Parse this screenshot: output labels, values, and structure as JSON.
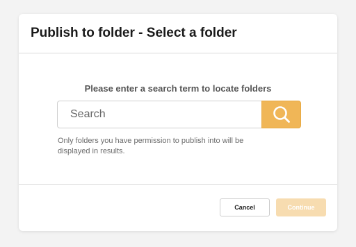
{
  "dialog": {
    "title": "Publish to folder - Select a folder"
  },
  "body": {
    "prompt": "Please enter a search term to locate folders",
    "search": {
      "placeholder": "Search",
      "value": "",
      "button_icon": "search-icon"
    },
    "hint": "Only folders you have permission to publish into will be displayed in results."
  },
  "footer": {
    "cancel_label": "Cancel",
    "continue_label": "Continue",
    "continue_disabled": true
  },
  "colors": {
    "accent": "#f0b657",
    "accent_disabled": "#f7dcb0"
  }
}
